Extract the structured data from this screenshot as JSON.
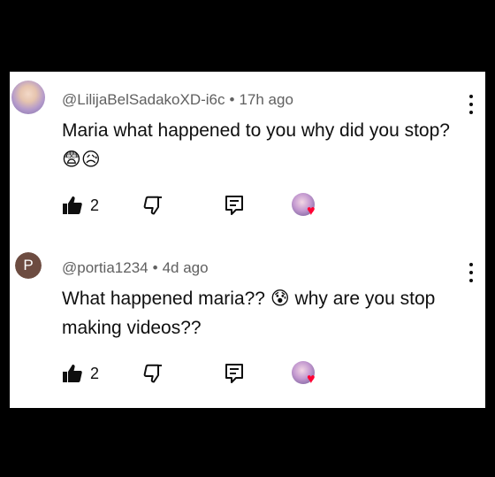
{
  "comments": [
    {
      "avatar_type": "image",
      "username": "@LilijaBelSadakoXD-i6c",
      "time": "17h ago",
      "text": "Maria what happened to you why did you stop?😨😥",
      "likes": "2"
    },
    {
      "avatar_type": "letter",
      "avatar_letter": "P",
      "avatar_color": "#6d4c41",
      "username": "@portia1234",
      "time": "4d ago",
      "text": "What happened maria?? 😰 why are you stop making videos??",
      "likes": "2"
    }
  ],
  "separator": "•",
  "icons": {
    "like": "thumbs-up-icon",
    "dislike": "thumbs-down-icon",
    "reply": "reply-icon",
    "more": "more-vert-icon",
    "creator_heart": "creator-heart-icon"
  },
  "colors": {
    "background": "#000000",
    "panel": "#ffffff",
    "text": "#0f0f0f",
    "meta": "#606060",
    "heart": "#ff0033"
  }
}
